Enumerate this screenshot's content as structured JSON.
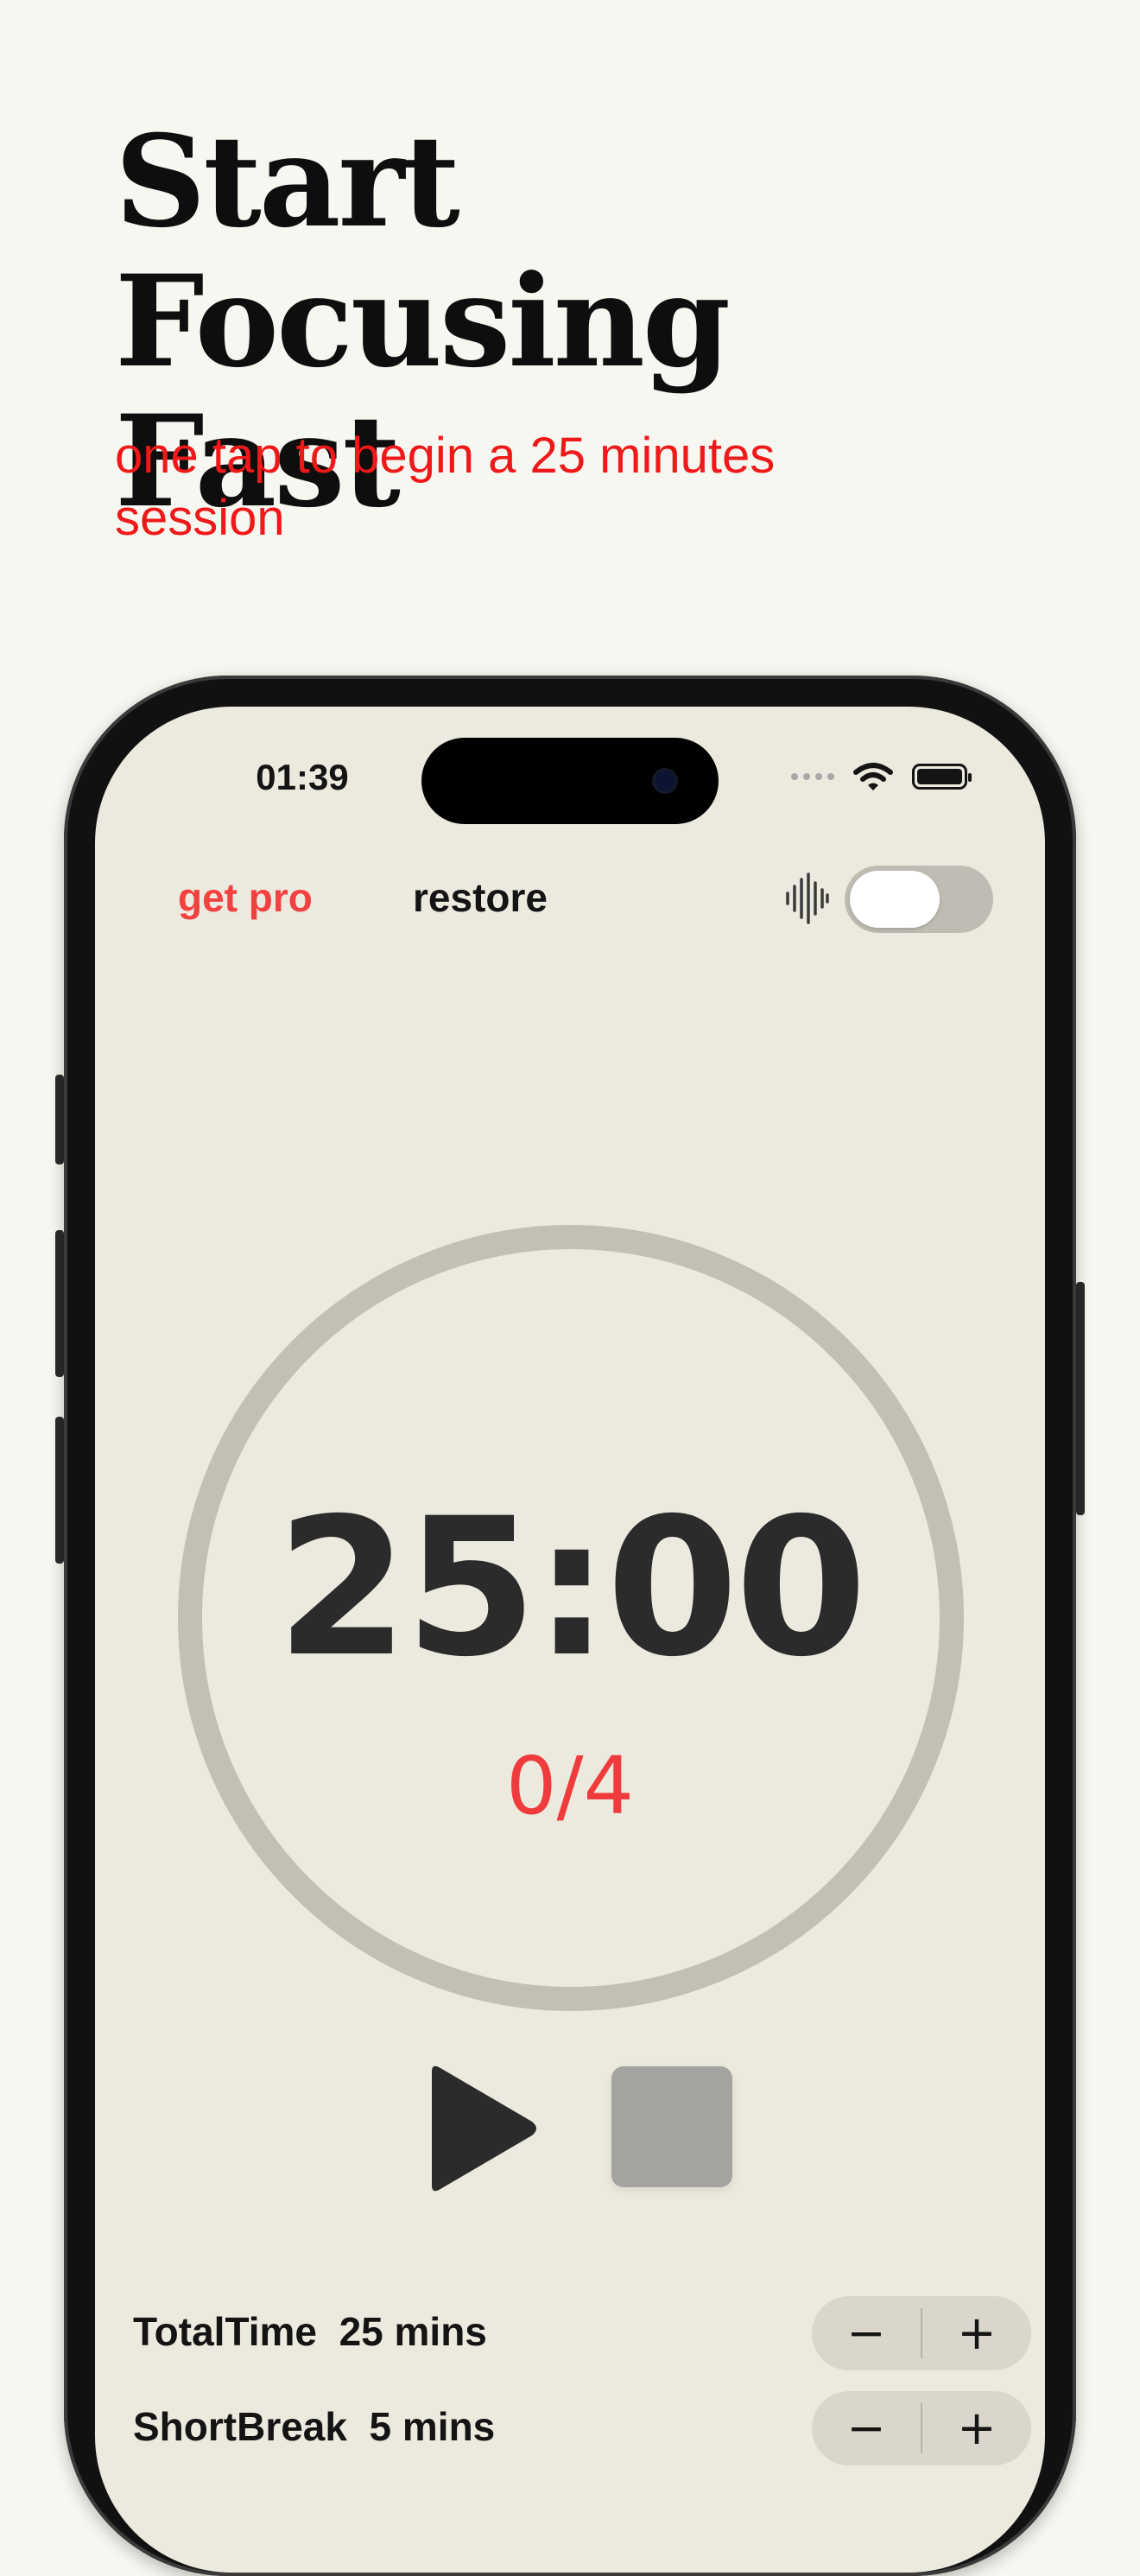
{
  "marketing": {
    "headline_line1": "Start Focusing",
    "headline_line2": "Fast",
    "subheadline": "one tap to begin a 25 minutes session"
  },
  "status_bar": {
    "time": "01:39"
  },
  "top_bar": {
    "get_pro_label": "get pro",
    "restore_label": "restore",
    "sound_toggle_on": false
  },
  "timer": {
    "display": "25:00",
    "sessions_completed": "0/4"
  },
  "settings": [
    {
      "name": "TotalTime",
      "value": "25 mins",
      "decrement": "−",
      "increment": "+"
    },
    {
      "name": "ShortBreak",
      "value": "5 mins",
      "decrement": "−",
      "increment": "+"
    }
  ],
  "colors": {
    "accent": "#f24141",
    "headline_text": "#0e0e0e",
    "subheadline_text": "#f01919",
    "screen_bg": "#ece9de",
    "page_bg": "#f7f7f1"
  },
  "icons": [
    "wifi-icon",
    "battery-icon",
    "sound-wave-icon",
    "play-icon",
    "stop-icon"
  ]
}
